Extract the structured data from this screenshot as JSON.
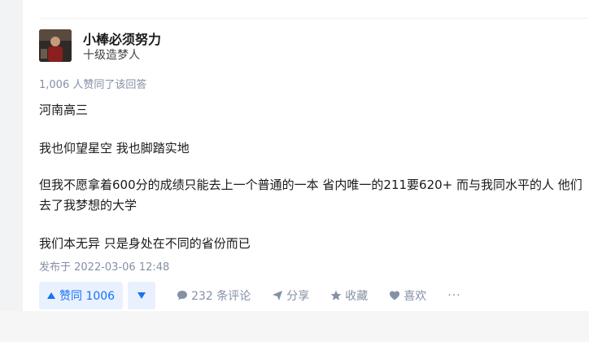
{
  "author": {
    "name": "小棒必须努力",
    "headline": "十级造梦人"
  },
  "vote_summary": "1,006 人赞同了该回答",
  "content": {
    "paragraphs": [
      "河南高三",
      "我也仰望星空 我也脚踏实地",
      "但我不愿拿着600分的成绩只能去上一个普通的一本 省内唯一的211要620+ 而与我同水平的人 他们去了我梦想的大学",
      "我们本无异 只是身处在不同的省份而已"
    ]
  },
  "publish_time": "发布于 2022-03-06 12:48",
  "actions": {
    "vote_up_label": "赞同 1006",
    "comments_label": "232 条评论",
    "share_label": "分享",
    "collect_label": "收藏",
    "like_label": "喜欢",
    "more_label": "···"
  },
  "colors": {
    "accent": "#1772f6",
    "muted": "#8590a6",
    "vote_bg": "#e9f1ff"
  }
}
